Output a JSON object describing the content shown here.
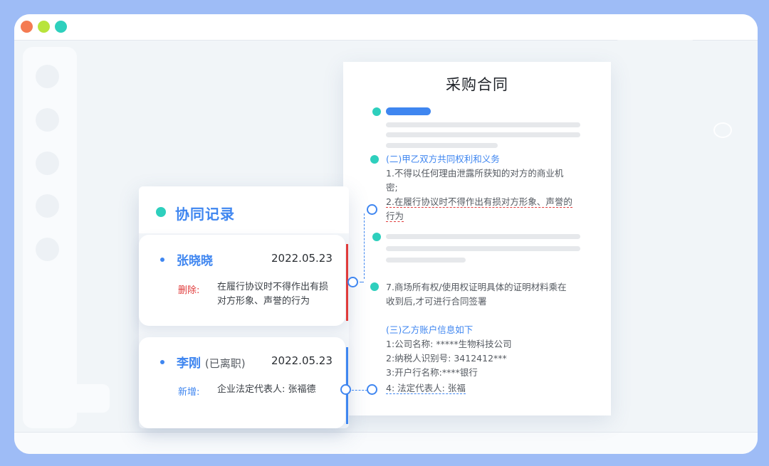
{
  "document": {
    "title": "采购合同",
    "section2_heading": "(二)甲乙双方共同权利和义务",
    "clause1_line1": "1.不得以任何理由泄露所获知的对方的商业机",
    "clause1_line2": "密;",
    "clause2_line1": "2.在履行协议时不得作出有损对方形象、声誉的",
    "clause2_line2": "行为",
    "clause7_line1": "7.商场所有权/使用权证明具体的证明材料乘在",
    "clause7_line2": "收到后,才可进行合同签署",
    "section3_heading": "(三)乙方账户信息如下",
    "account1": "1:公司名称: *****生物科技公司",
    "account2": "2:纳税人识别号:  3412412***",
    "account3": "3:开户行名称:****银行",
    "account4": "4: 法定代表人:  张福"
  },
  "records": {
    "title": "协同记录",
    "items": [
      {
        "name": "张晓晓",
        "note": "",
        "date": "2022.05.23",
        "action": "删除:",
        "content": "在履行协议时不得作出有损对方形象、声誉的行为"
      },
      {
        "name": "李刚",
        "note": "(已离职)",
        "date": "2022.05.23",
        "action": "新增:",
        "content": "企业法定代表人:  张福德"
      }
    ]
  },
  "colors": {
    "accent_blue": "#3f86f0",
    "teal": "#2ecfbd",
    "delete_red": "#e03b3b",
    "background": "#9ebcf6"
  }
}
